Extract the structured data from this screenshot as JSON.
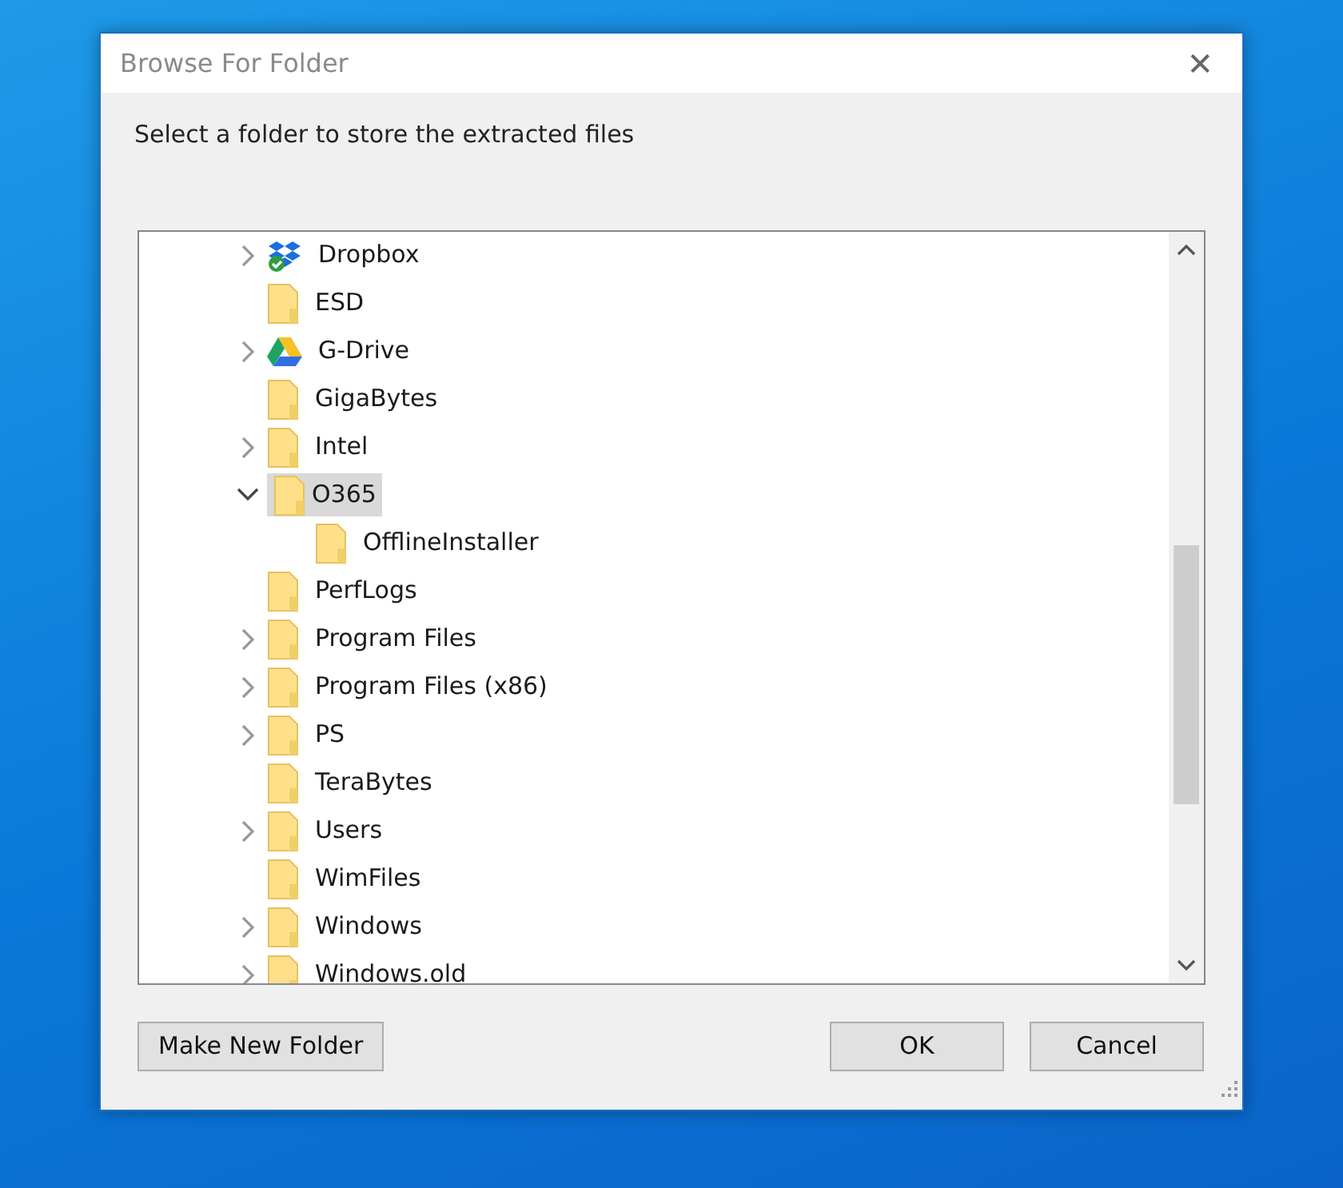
{
  "window": {
    "title": "Browse For Folder",
    "close": "✕"
  },
  "prompt": "Select a folder to store the extracted files",
  "tree": [
    {
      "label": "Dropbox",
      "kind": "dropbox",
      "expandable": true,
      "expanded": false,
      "selected": false
    },
    {
      "label": "ESD",
      "kind": "folder",
      "expandable": false,
      "selected": false
    },
    {
      "label": "G-Drive",
      "kind": "gdrive",
      "expandable": true,
      "expanded": false,
      "selected": false
    },
    {
      "label": "GigaBytes",
      "kind": "folder",
      "expandable": false,
      "selected": false
    },
    {
      "label": "Intel",
      "kind": "folder",
      "expandable": true,
      "expanded": false,
      "selected": false
    },
    {
      "label": "O365",
      "kind": "folder",
      "expandable": true,
      "expanded": true,
      "selected": true,
      "children": [
        {
          "label": "OfflineInstaller",
          "kind": "folder",
          "expandable": false,
          "selected": false
        }
      ]
    },
    {
      "label": "PerfLogs",
      "kind": "folder",
      "expandable": false,
      "selected": false
    },
    {
      "label": "Program Files",
      "kind": "folder",
      "expandable": true,
      "expanded": false,
      "selected": false
    },
    {
      "label": "Program Files (x86)",
      "kind": "folder",
      "expandable": true,
      "expanded": false,
      "selected": false
    },
    {
      "label": "PS",
      "kind": "folder",
      "expandable": true,
      "expanded": false,
      "selected": false
    },
    {
      "label": "TeraBytes",
      "kind": "folder",
      "expandable": false,
      "selected": false
    },
    {
      "label": "Users",
      "kind": "folder",
      "expandable": true,
      "expanded": false,
      "selected": false
    },
    {
      "label": "WimFiles",
      "kind": "folder",
      "expandable": false,
      "selected": false
    },
    {
      "label": "Windows",
      "kind": "folder",
      "expandable": true,
      "expanded": false,
      "selected": false
    },
    {
      "label": "Windows.old",
      "kind": "folder",
      "expandable": true,
      "expanded": false,
      "selected": false
    }
  ],
  "buttons": {
    "left": "Make New Folder",
    "ok": "OK",
    "cancel": "Cancel"
  }
}
